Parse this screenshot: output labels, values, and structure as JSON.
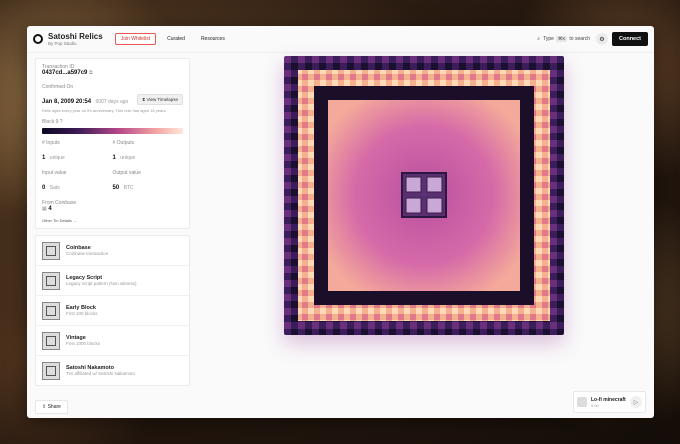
{
  "header": {
    "title": "Satoshi Relics",
    "subtitle": "By Pop Studio",
    "nav": [
      {
        "label": "Join Whitelist"
      },
      {
        "label": "Curated"
      },
      {
        "label": "Resources"
      }
    ],
    "search": {
      "prefix": "Type",
      "key": "⌘K",
      "suffix": "to search"
    },
    "connect": "Connect"
  },
  "tx": {
    "id_label": "Transaction ID",
    "id": "0437cd...a597c9",
    "confirmed_label": "Confirmed On",
    "date": "Jan 8, 2009 20:54",
    "ago": "6007 days ago",
    "age_note": "Relic ages every year on it's anniversary. This relic has aged 16 years.",
    "timelapse": "View Timelapse",
    "block_label": "Block 9",
    "inputs_label": "# Inputs",
    "inputs": "1",
    "inputs_unit": "unique",
    "outputs_label": "# Outputs",
    "outputs": "1",
    "outputs_unit": "unique",
    "input_value_label": "Input value",
    "input_value": "0",
    "input_unit": "Sats",
    "output_value_label": "Output value",
    "output_value": "50",
    "output_unit": "BTC",
    "from_label": "From Coinbase",
    "from_value": "4",
    "details": "Other Tin Details"
  },
  "attributes": [
    {
      "title": "Coinbase",
      "sub": "Coinbase transaction"
    },
    {
      "title": "Legacy Script",
      "sub": "Legacy script pattern (Non witness)"
    },
    {
      "title": "Early Block",
      "sub": "First 100 blocks"
    },
    {
      "title": "Vintage",
      "sub": "First 1000 blocks"
    },
    {
      "title": "Satoshi Nakamoto",
      "sub": "Txs affiliated w/ Satoshi Nakamoto"
    }
  ],
  "share": "Share",
  "music": {
    "title": "Lo-fi minecraft",
    "time": "0:00"
  },
  "colors": {
    "accent": "#e55555",
    "art_light": "#f6c0a0",
    "art_mid": "#c94f9a",
    "art_dark": "#2a1640"
  }
}
